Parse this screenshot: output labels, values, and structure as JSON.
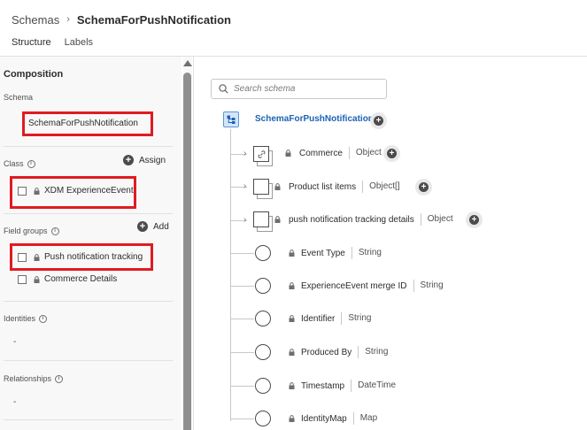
{
  "breadcrumb": {
    "root": "Schemas",
    "separator": "›",
    "current": "SchemaForPushNotification"
  },
  "tabs": [
    {
      "label": "Structure",
      "active": true
    },
    {
      "label": "Labels",
      "active": false
    }
  ],
  "composition": {
    "title": "Composition",
    "schema": {
      "label": "Schema",
      "name": "SchemaForPushNotification"
    },
    "class": {
      "label": "Class",
      "action_label": "Assign",
      "items": [
        "XDM ExperienceEvent"
      ]
    },
    "field_groups": {
      "label": "Field groups",
      "action_label": "Add",
      "items": [
        "Push notification tracking",
        "Commerce Details"
      ]
    },
    "identities": {
      "label": "Identities",
      "value": "-"
    },
    "relationships": {
      "label": "Relationships",
      "value": "-"
    }
  },
  "search": {
    "placeholder": "Search schema"
  },
  "tree": {
    "root": "SchemaForPushNotification",
    "nodes": [
      {
        "name": "Commerce",
        "type": "Object",
        "kind": "object",
        "linked": true
      },
      {
        "name": "Product list items",
        "type": "Object[]",
        "kind": "object",
        "linked": false
      },
      {
        "name": "push notification tracking details",
        "type": "Object",
        "kind": "object",
        "linked": false
      },
      {
        "name": "Event Type",
        "type": "String",
        "kind": "field"
      },
      {
        "name": "ExperienceEvent merge ID",
        "type": "String",
        "kind": "field"
      },
      {
        "name": "Identifier",
        "type": "String",
        "kind": "field"
      },
      {
        "name": "Produced By",
        "type": "String",
        "kind": "field"
      },
      {
        "name": "Timestamp",
        "type": "DateTime",
        "kind": "field"
      },
      {
        "name": "IdentityMap",
        "type": "Map",
        "kind": "field"
      }
    ]
  },
  "colors": {
    "highlight": "#e01b22",
    "link": "#1b62b7",
    "root_icon_bg": "#d5e5f8"
  }
}
